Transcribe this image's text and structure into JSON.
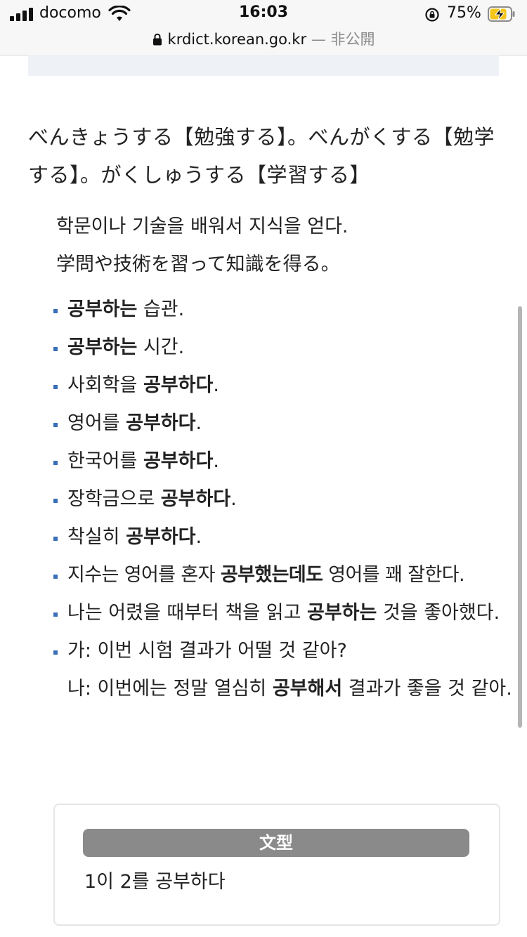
{
  "status_bar": {
    "carrier": "docomo",
    "time": "16:03",
    "battery_percent": "75%",
    "signal_bars": 4
  },
  "browser": {
    "url": "krdict.korean.go.kr",
    "privacy": "— 非公開"
  },
  "entry": {
    "japanese_translation": "べんきょうする【勉強する】。べんがくする【勉学する】。がくしゅうする【学習する】",
    "definition_ko": "학문이나 기술을 배워서 지식을 얻다.",
    "definition_ja": "学問や技術を習って知識を得る。",
    "examples": [
      {
        "before": "",
        "bold": "공부하는",
        "after": " 습관."
      },
      {
        "before": "",
        "bold": "공부하는",
        "after": " 시간."
      },
      {
        "before": "사회학을 ",
        "bold": "공부하다",
        "after": "."
      },
      {
        "before": "영어를 ",
        "bold": "공부하다",
        "after": "."
      },
      {
        "before": "한국어를 ",
        "bold": "공부하다",
        "after": "."
      },
      {
        "before": "장학금으로 ",
        "bold": "공부하다",
        "after": "."
      },
      {
        "before": "착실히 ",
        "bold": "공부하다",
        "after": "."
      },
      {
        "before": "지수는 영어를 혼자 ",
        "bold": "공부했는데도",
        "after": " 영어를 꽤 잘한다."
      },
      {
        "before": "나는 어렸을 때부터 책을 읽고 ",
        "bold": "공부하는",
        "after": " 것을 좋아했다."
      }
    ],
    "dialogue": {
      "line_a": "가: 이번 시험 결과가 어떨 것 같아?",
      "line_b_before": "나: 이번에는 정말 열심히 ",
      "line_b_bold": "공부해서",
      "line_b_after": " 결과가 좋을 것 같아."
    },
    "pattern": {
      "header": "文型",
      "text": "1이 2를 공부하다"
    }
  },
  "colors": {
    "bullet": "#3a6fb8",
    "pattern_header_bg": "#8a8a8a",
    "band": "#eef1f5"
  },
  "icons": [
    "signal-icon",
    "wifi-icon",
    "rotation-lock-icon",
    "battery-charging-icon",
    "lock-icon"
  ]
}
